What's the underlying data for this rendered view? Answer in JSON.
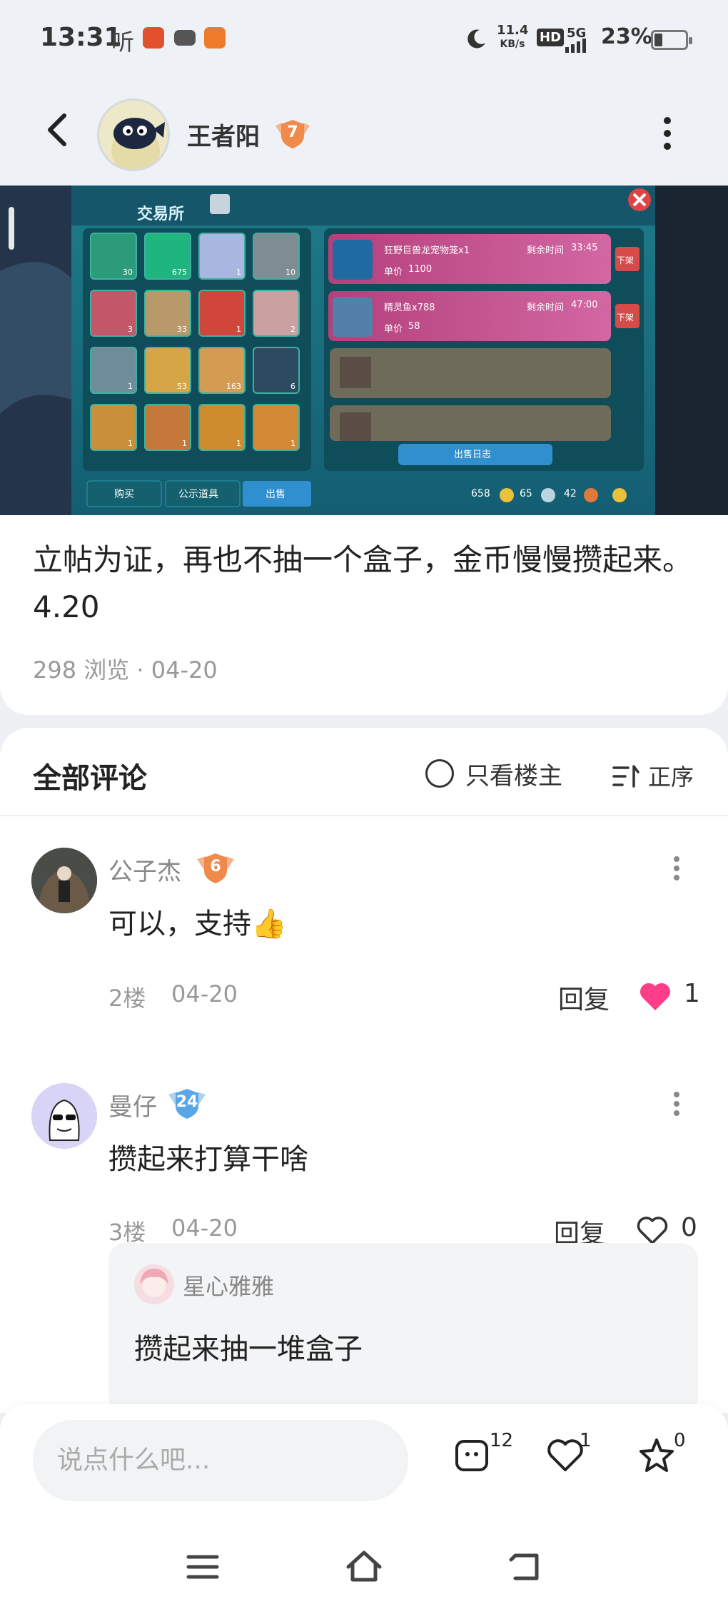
{
  "status_bar": {
    "time": "13:31",
    "listen": "听",
    "net_speed_top": "11.4",
    "net_speed_bottom": "KB/s",
    "hd": "HD",
    "signal": "5G",
    "battery": "23%"
  },
  "header": {
    "author": "王者阳",
    "level": "7"
  },
  "game_screenshot": {
    "title": "交易所",
    "listings": [
      {
        "name": "狂野巨兽龙宠物笼x1",
        "time_label": "剩余时间",
        "time": "33:45",
        "price_label": "单价",
        "price": "1100",
        "action": "下架"
      },
      {
        "name": "精灵鱼x788",
        "time_label": "剩余时间",
        "time": "47:00",
        "price_label": "单价",
        "price": "58",
        "action": "下架"
      }
    ],
    "item_counts": [
      "30",
      "675",
      "1",
      "10",
      "3",
      "33",
      "1",
      "2",
      "1",
      "53",
      "163",
      "6",
      "1",
      "1",
      "1",
      "1"
    ],
    "log_button": "出售日志",
    "tabs": [
      "购买",
      "公示道具",
      "出售"
    ],
    "currency": [
      "658",
      "65",
      "42"
    ]
  },
  "post": {
    "text": "立帖为证，再也不抽一个盒子，金币慢慢攒起来。4.20",
    "meta": "298 浏览 · 04-20"
  },
  "comments_section": {
    "title": "全部评论",
    "only_owner": "只看楼主",
    "sort": "正序",
    "items": [
      {
        "name": "公子杰",
        "level": "6",
        "text": "可以，支持👍",
        "floor": "2楼",
        "date": "04-20",
        "reply": "回复",
        "likes": "1",
        "liked": true
      },
      {
        "name": "曼仔",
        "level": "24",
        "text": "攒起来打算干啥",
        "floor": "3楼",
        "date": "04-20",
        "reply": "回复",
        "likes": "0",
        "liked": false
      }
    ],
    "sub_reply": {
      "name": "星心雅雅",
      "text": "攒起来抽一堆盒子"
    }
  },
  "bottom_bar": {
    "placeholder": "说点什么吧...",
    "comment_count": "12",
    "like_count": "1",
    "favorite_count": "0"
  },
  "colors": {
    "like_active": "#ff3d8a",
    "badge_orange": "#f08a4b",
    "badge_blue": "#5aa7e8"
  }
}
